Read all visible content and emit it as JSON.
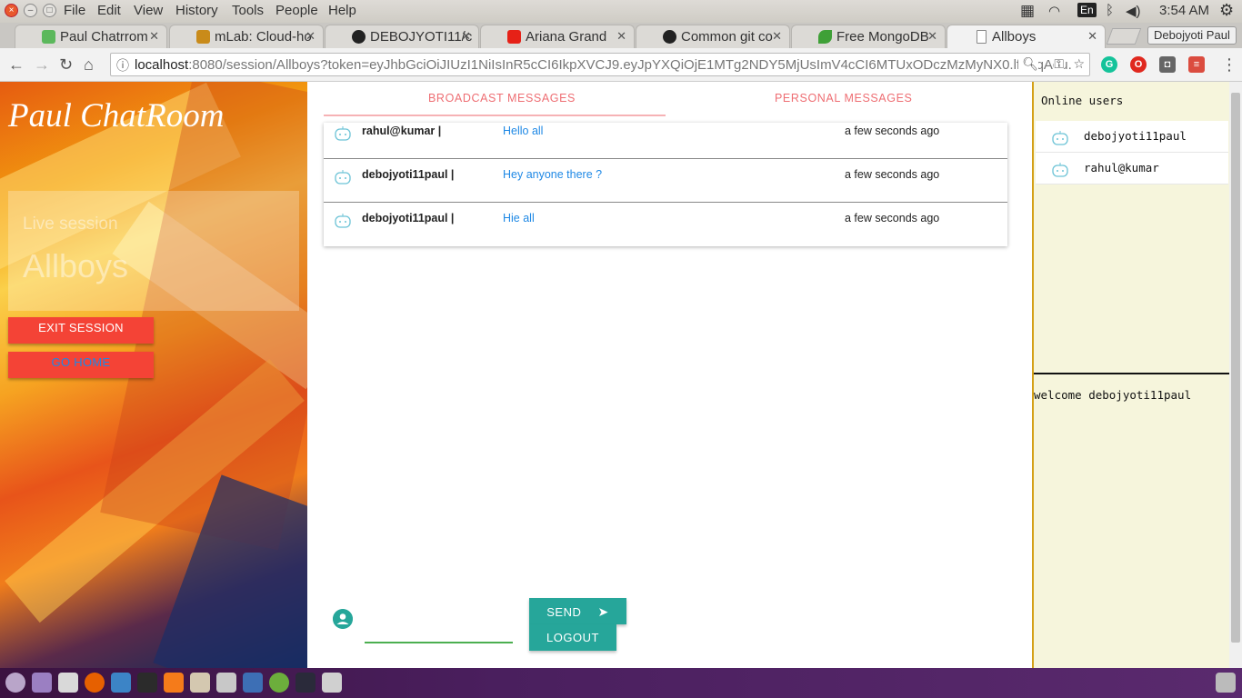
{
  "os_menu": {
    "items": [
      "File",
      "Edit",
      "View",
      "History",
      "Tools",
      "People",
      "Help"
    ],
    "lang": "En",
    "clock": "3:54 AM"
  },
  "tabs": [
    {
      "title": "Paul Chatrrom",
      "icon": "green-cube-icon",
      "color": "#5cb85c"
    },
    {
      "title": "mLab: Cloud-ho",
      "icon": "mlab-icon",
      "color": "#c98b1a"
    },
    {
      "title": "DEBOJYOTI11/c",
      "icon": "github-icon",
      "color": "#222222"
    },
    {
      "title": "Ariana Grand",
      "icon": "youtube-icon",
      "color": "#e62117"
    },
    {
      "title": "Common git co",
      "icon": "github-icon",
      "color": "#222222"
    },
    {
      "title": "Free MongoDB",
      "icon": "mongodb-leaf-icon",
      "color": "#3fa037"
    },
    {
      "title": "Allboys",
      "icon": "page-icon",
      "color": "#888888"
    }
  ],
  "profile_name": "Debojyoti Paul",
  "address": {
    "host": "localhost",
    "rest": ":8080/session/Allboys?token=eyJhbGciOiJIUzI1NiIsInR5cCI6IkpXVCJ9.eyJpYXQiOjE1MTg2NDY5MjUsImV4cCI6MTUxODczMzMyNX0.lfAzqAqu..."
  },
  "sidebar": {
    "brand": "Paul ChatRoom",
    "session_label": "Live session",
    "session_name": "Allboys",
    "exit_label": "EXIT SESSION",
    "home_label": "GO HOME"
  },
  "center": {
    "tab_broadcast": "BROADCAST MESSAGES",
    "tab_personal": "PERSONAL MESSAGES",
    "messages": [
      {
        "user": "rahul@kumar  |",
        "text": "Hello all",
        "time": "a few seconds ago"
      },
      {
        "user": "debojyoti11paul |",
        "text": "Hey anyone there ?",
        "time": "a few seconds ago"
      },
      {
        "user": "debojyoti11paul |",
        "text": "Hie all",
        "time": "a few seconds ago"
      }
    ],
    "input_value": "",
    "send_label": "SEND",
    "logout_label": "LOGOUT"
  },
  "right": {
    "header": "Online users",
    "users": [
      "debojyoti11paul",
      "rahul@kumar"
    ],
    "welcome": "welcome debojyoti11paul"
  },
  "colors": {
    "accent_red": "#f44336",
    "teal": "#26a69a",
    "tab_text": "#ee6e73",
    "link_blue": "#1e88e5",
    "panel_bg": "#f6f5dc"
  }
}
